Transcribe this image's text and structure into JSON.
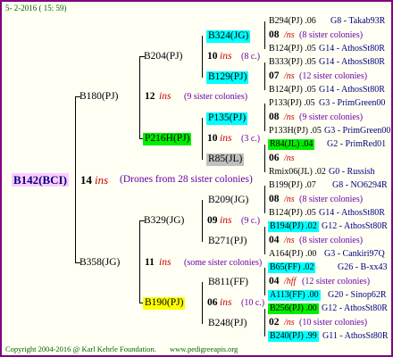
{
  "header": {
    "date": "5- 2-2016 ( 15: 59)"
  },
  "footer": {
    "copyright": "Copyright 2004-2016 @ Karl Kehrle Foundation.",
    "url": "www.pedigreeapis.org"
  },
  "colors": {
    "frame": "#800080",
    "cyan": "#00ffff",
    "green": "#00ee00",
    "yellow": "#ffff00",
    "gray": "#c0c0c0",
    "pink": "#ffccff",
    "ins_red": "#cc0000",
    "sister_purple": "#6a00a8"
  },
  "root": {
    "id": "B142(BCI)",
    "year": "14",
    "ins": "ins",
    "note": "(Drones from 28 sister colonies)"
  },
  "gen1": [
    {
      "id": "B180(PJ)",
      "year": "12",
      "ins": "ins",
      "note": "(9 sister colonies)"
    },
    {
      "id": "B358(JG)",
      "year": "11",
      "ins": "ins",
      "note": "(some sister colonies)"
    }
  ],
  "gen2": [
    {
      "id": "B204(PJ)",
      "year": "10",
      "ins": "ins",
      "note": "(8 c.)"
    },
    {
      "id": "P216H(PJ)",
      "year": "10",
      "ins": "ins",
      "note": "(3 c.)"
    },
    {
      "id": "B329(JG)",
      "year": "09",
      "ins": "ins",
      "note": "(9 c.)"
    },
    {
      "id": "B190(PJ)",
      "year": "06",
      "ins": "ins",
      "note": "(10 c.)"
    }
  ],
  "gen3": [
    {
      "id": "B324(JG)"
    },
    {
      "id": "B129(PJ)"
    },
    {
      "id": "P135(PJ)"
    },
    {
      "id": "R85(JL)"
    },
    {
      "id": "B209(JG)"
    },
    {
      "id": "B271(PJ)"
    },
    {
      "id": "B811(FF)"
    },
    {
      "id": "B248(PJ)"
    }
  ],
  "gen4": [
    {
      "top": "B294(PJ) .06",
      "top_line": "G8 - Takab93R",
      "mid_year": "08",
      "mid_ins": "/ns",
      "mid_note": "(8 sister colonies)",
      "bot": "B124(PJ) .05",
      "bot_line": "G14 - AthosSt80R"
    },
    {
      "top": "B333(PJ) .05",
      "top_line": "G14 - AthosSt80R",
      "mid_year": "07",
      "mid_ins": "/ns",
      "mid_note": "(12 sister colonies)",
      "bot": "B124(PJ) .05",
      "bot_line": "G14 - AthosSt80R"
    },
    {
      "top": "P133(PJ) .05",
      "top_line": "G3 - PrimGreen00",
      "mid_year": "08",
      "mid_ins": "/ns",
      "mid_note": "(9 sister colonies)",
      "bot": "P133H(PJ) .05",
      "bot_line": "G3 - PrimGreen00"
    },
    {
      "top": "R84(JL) .04",
      "top_line": "G2 - PrimRed01",
      "mid_year": "06",
      "mid_ins": "/ns",
      "mid_note": "",
      "bot": "Rmix06(JL) .02",
      "bot_line": "G0 - Russish"
    },
    {
      "top": "B199(PJ) .07",
      "top_line": "G8 - NO6294R",
      "mid_year": "08",
      "mid_ins": "/ns",
      "mid_note": "(8 sister colonies)",
      "bot": "B124(PJ) .05",
      "bot_line": "G14 - AthosSt80R"
    },
    {
      "top": "B194(PJ) .02",
      "top_line": "G12 - AthosSt80R",
      "mid_year": "04",
      "mid_ins": "/ns",
      "mid_note": "(8 sister colonies)",
      "bot": "A164(PJ) .00",
      "bot_line": "G3 - Cankiri97Q"
    },
    {
      "top": "B65(FF) .02",
      "top_line": "G26 - B-xx43",
      "mid_year": "04",
      "mid_ins": "/hff",
      "mid_note": "(12 sister colonies)",
      "bot": "A113(FF) .00",
      "bot_line": "G20 - Sinop62R"
    },
    {
      "top": "B256(PJ) .00",
      "top_line": "G12 - AthosSt80R",
      "mid_year": "02",
      "mid_ins": "/ns",
      "mid_note": "(10 sister colonies)",
      "bot": "B240(PJ) .99",
      "bot_line": "G11 - AthosSt80R"
    }
  ]
}
